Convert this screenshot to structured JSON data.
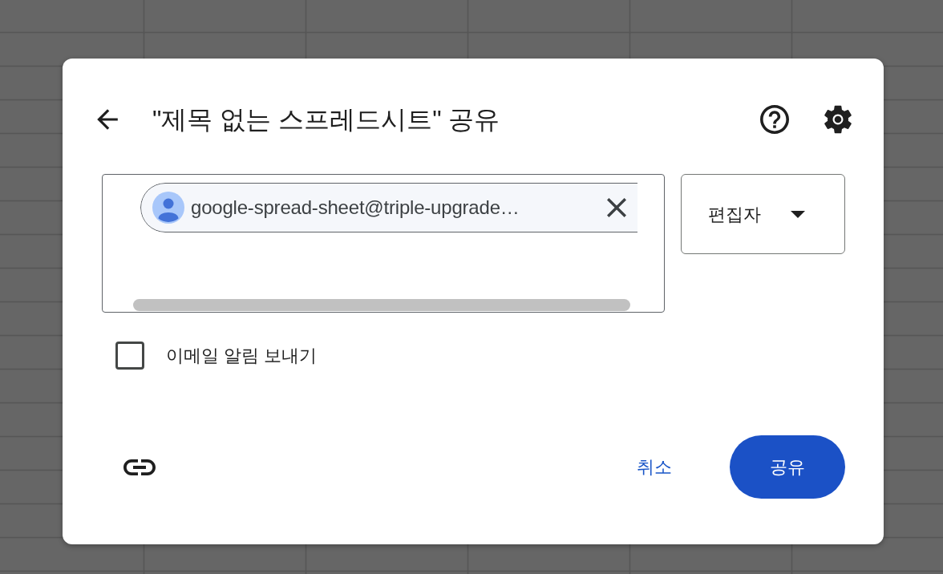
{
  "dialog": {
    "title": "\"제목 없는 스프레드시트\" 공유",
    "recipients": [
      {
        "email": "google-spread-sheet@triple-upgrade…"
      }
    ],
    "role": {
      "value": "편집자"
    },
    "notify": {
      "label": "이메일 알림 보내기",
      "checked": false
    },
    "buttons": [
      {
        "label": "취소",
        "kind": "text"
      },
      {
        "label": "공유",
        "kind": "filled"
      }
    ]
  }
}
